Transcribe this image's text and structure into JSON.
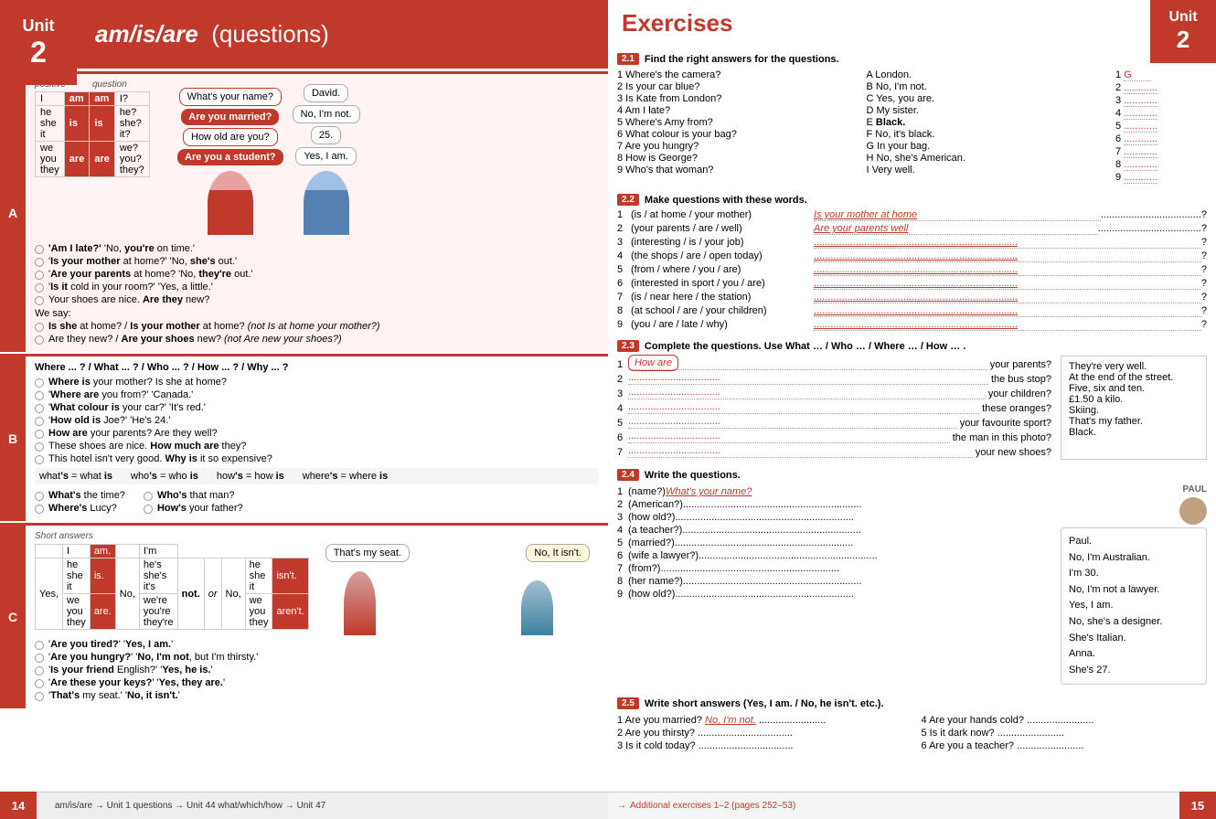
{
  "left": {
    "unit_word": "Unit",
    "unit_num": "2",
    "title": "am/is/are",
    "title_paren": "(questions)",
    "section_a_label": "A",
    "section_b_label": "B",
    "section_c_label": "C",
    "grammar_headers": [
      "positive",
      "question"
    ],
    "grammar_rows": [
      {
        "pronoun": "I",
        "pos_verb": "am",
        "q_verb": "am",
        "q_rest": "I?"
      },
      {
        "pronoun": "he/she/it",
        "pos_verb": "is",
        "q_verb": "is",
        "q_rest": "he?/she?/it?"
      },
      {
        "pronoun": "we/you/they",
        "pos_verb": "are",
        "q_verb": "are",
        "q_rest": "we?/you?/they?"
      }
    ],
    "dialog_bubbles": [
      "What's your name?",
      "Are you married?",
      "How old are you?",
      "Are you a student?"
    ],
    "dialog_responses": [
      "David.",
      "No, I'm not.",
      "25.",
      "Yes, I am."
    ],
    "section_a_bullets": [
      "'Am I late?'  'No, you're on time.'",
      "'Is your mother at home?'  'No, she's out.'",
      "'Are your parents at home?  'No, they're out.'",
      "'Is it cold in your room?'  'Yes, a little.'",
      "Your shoes are nice.  Are they new?"
    ],
    "section_a_note1": "Is she at home? / Is your mother at home?  (not Is at home your mother?)",
    "section_a_note2": "Are they new? / Are your shoes new?  (not Are new your shoes?)",
    "section_b_header": "Where ... ? / What ... ? / Who ... ? / How ... ? / Why ... ?",
    "section_b_bullets": [
      "Where is your mother?  Is she at home?",
      "'Where are you from?'  'Canada.'",
      "'What colour is your car?'  'It's red.'",
      "'How old is Joe?'  'He's 24.'",
      "How are your parents?  Are they well?",
      "These shoes are nice.  How much are they?",
      "This hotel isn't very good.  Why is it so expensive?"
    ],
    "contractions": [
      "what's = what is",
      "who's = who is",
      "how's = how is",
      "where's = where is"
    ],
    "section_b_bullets2": [
      "What's the time?",
      "Where's Lucy?",
      "Who's that man?",
      "How's your father?"
    ],
    "section_c_label_text": "Short answers",
    "short_ans_bullets": [
      "'Are you tired?'  'Yes, I am.'",
      "'Are you hungry?'  'No, I'm not, but I'm thirsty.'",
      "'Is your friend English?'  'Yes, he is.'",
      "'Are these your keys?'  'Yes, they are.'",
      "'That's my seat.'  'No, it isn't.'"
    ],
    "seat_bubble1": "That's my seat.",
    "seat_bubble2": "No, It isn't.",
    "page_num": "14",
    "footer_text": "am/is/are → Unit 1   questions → Unit 44   what/which/how → Unit 47"
  },
  "right": {
    "exercises_title": "Exercises",
    "unit_word": "Unit",
    "unit_num": "2",
    "ex21_num": "2.1",
    "ex21_instruction": "Find the right answers for the questions.",
    "ex21_questions": [
      "1  Where's the camera?",
      "2  Is your car blue?",
      "3  Is Kate from London?",
      "4  Am I late?",
      "5  Where's Amy from?",
      "6  What colour is your bag?",
      "7  Are you hungry?",
      "8  How is George?",
      "9  Who's that woman?"
    ],
    "ex21_answers": [
      "A  London.",
      "B  No, I'm not.",
      "C  Yes, you are.",
      "D  My sister.",
      "E  Black.",
      "F  No, it's black.",
      "G  In your bag.",
      "H  No, she's American.",
      "I  Very well."
    ],
    "ex21_filled": [
      "G",
      "2",
      "3",
      "4",
      "5",
      "6",
      "7",
      "8",
      "9"
    ],
    "ex22_num": "2.2",
    "ex22_instruction": "Make questions with these words.",
    "ex22_rows": [
      {
        "num": "1",
        "words": "(is / at home / your mother)",
        "answer": "Is your mother at home"
      },
      {
        "num": "2",
        "words": "(your parents / are / well)",
        "answer": "Are your parents well"
      },
      {
        "num": "3",
        "words": "(interesting / is / your job)",
        "answer": ""
      },
      {
        "num": "4",
        "words": "(the shops / are / open today)",
        "answer": ""
      },
      {
        "num": "5",
        "words": "(from / where / you / are)",
        "answer": ""
      },
      {
        "num": "6",
        "words": "(interested in sport / you / are)",
        "answer": ""
      },
      {
        "num": "7",
        "words": "(is / near here / the station)",
        "answer": ""
      },
      {
        "num": "8",
        "words": "(at school / are / your children)",
        "answer": ""
      },
      {
        "num": "9",
        "words": "(you / are / late / why)",
        "answer": ""
      }
    ],
    "ex23_num": "2.3",
    "ex23_instruction": "Complete the questions.  Use What … / Who … / Where … / How … .",
    "ex23_rows": [
      {
        "num": "1",
        "prefix_answer": "How are",
        "suffix": "your parents?"
      },
      {
        "num": "2",
        "prefix_answer": "",
        "suffix": "the bus stop?"
      },
      {
        "num": "3",
        "prefix_answer": "",
        "suffix": "your children?"
      },
      {
        "num": "4",
        "prefix_answer": "",
        "suffix": "these oranges?"
      },
      {
        "num": "5",
        "prefix_answer": "",
        "suffix": "your favourite sport?"
      },
      {
        "num": "6",
        "prefix_answer": "",
        "suffix": "the man in this photo?"
      },
      {
        "num": "7",
        "prefix_answer": "",
        "suffix": "your new shoes?"
      }
    ],
    "ex23_responses": [
      "They're very well.",
      "At the end of the street.",
      "Five, six and ten.",
      "£1.50 a kilo.",
      "Skiing.",
      "That's my father.",
      "Black."
    ],
    "ex24_num": "2.4",
    "ex24_instruction": "Write the questions.",
    "ex24_rows": [
      {
        "num": "1",
        "prompt": "(name?)",
        "answer": "What's your name?"
      },
      {
        "num": "2",
        "prompt": "(American?)",
        "answer": ""
      },
      {
        "num": "3",
        "prompt": "(how old?)",
        "answer": ""
      },
      {
        "num": "4",
        "prompt": "(a teacher?)",
        "answer": ""
      },
      {
        "num": "5",
        "prompt": "(married?)",
        "answer": ""
      },
      {
        "num": "6",
        "prompt": "(wife a lawyer?)",
        "answer": ""
      },
      {
        "num": "7",
        "prompt": "(from?)",
        "answer": ""
      },
      {
        "num": "8",
        "prompt": "(her name?)",
        "answer": ""
      },
      {
        "num": "9",
        "prompt": "(how old?)",
        "answer": ""
      }
    ],
    "ex24_paul_answers": [
      "Paul.",
      "No, I'm Australian.",
      "I'm 30.",
      "No, I'm not a lawyer.",
      "Yes, I am.",
      "No, she's a designer.",
      "She's Italian.",
      "Anna.",
      "She's 27."
    ],
    "ex24_paul_label": "PAUL",
    "ex25_num": "2.5",
    "ex25_instruction": "Write short answers (Yes, I am. / No, he isn't. etc.).",
    "ex25_col1": [
      {
        "num": "1",
        "q": "Are you married?",
        "a": "No, I'm not."
      },
      {
        "num": "2",
        "q": "Are you thirsty?",
        "a": ""
      },
      {
        "num": "3",
        "q": "Is it cold today?",
        "a": ""
      }
    ],
    "ex25_col2": [
      {
        "num": "4",
        "q": "Are your hands cold?",
        "a": ""
      },
      {
        "num": "5",
        "q": "Is it dark now?",
        "a": ""
      },
      {
        "num": "6",
        "q": "Are you a teacher?",
        "a": ""
      }
    ],
    "footer_text": "→ Additional exercises 1–2 (pages 252–53)",
    "page_num": "15"
  }
}
